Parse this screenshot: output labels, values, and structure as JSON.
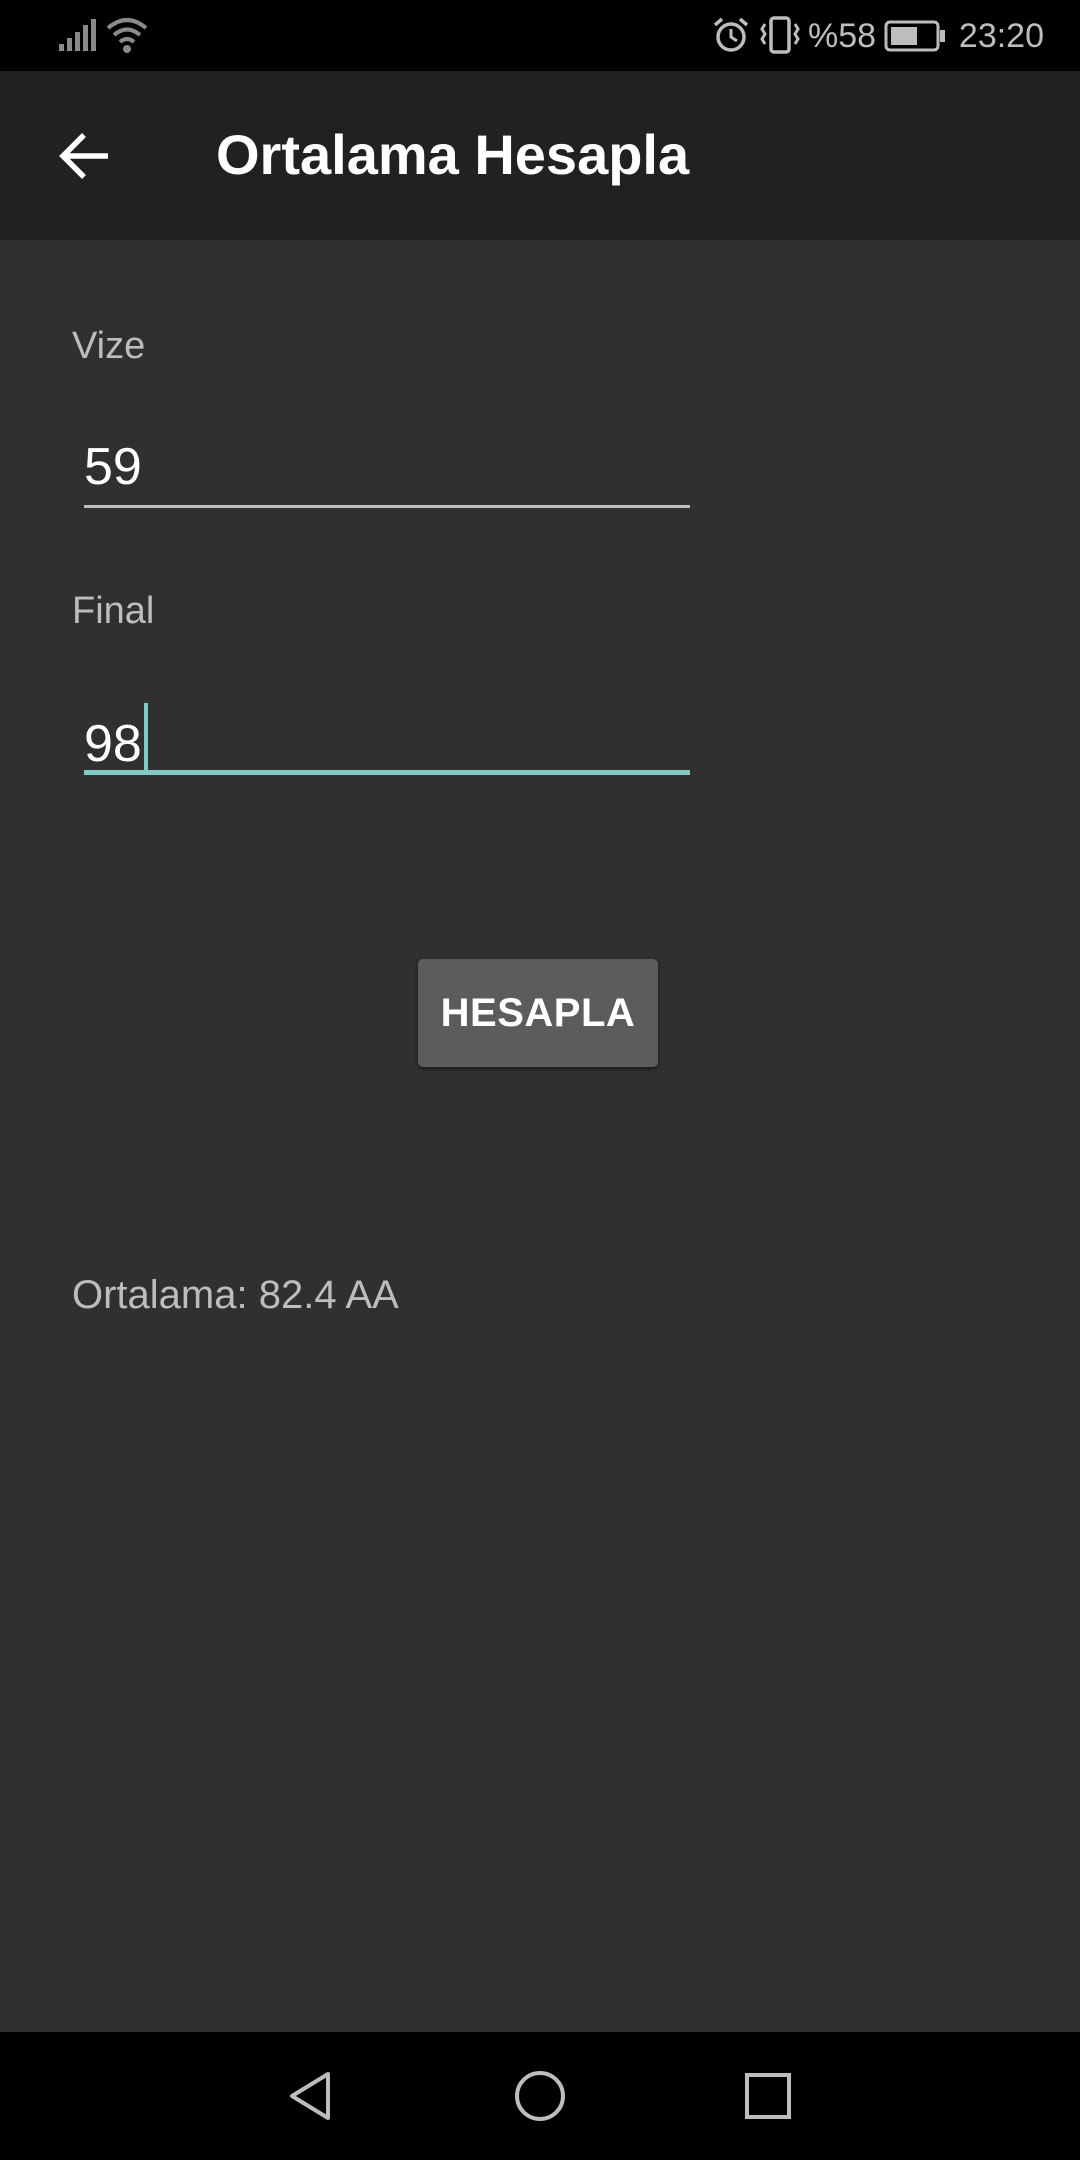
{
  "status_bar": {
    "battery_percent": "%58",
    "time": "23:20",
    "icons": [
      "signal-icon",
      "wifi-icon",
      "alarm-icon",
      "vibrate-icon",
      "battery-icon"
    ]
  },
  "app_bar": {
    "title": "Ortalama Hesapla",
    "back_icon": "arrow-back-icon"
  },
  "form": {
    "vize_label": "Vize",
    "vize_value": "59",
    "final_label": "Final",
    "final_value": "98",
    "button_label": "HESAPLA"
  },
  "result": {
    "text": "Ortalama: 82.4 AA"
  },
  "nav_bar": {
    "icons": [
      "nav-back-icon",
      "nav-home-icon",
      "nav-recents-icon"
    ]
  },
  "colors": {
    "background": "#303030",
    "app_bar": "#212121",
    "accent": "#80cbc4",
    "button": "#5c5c5c"
  }
}
